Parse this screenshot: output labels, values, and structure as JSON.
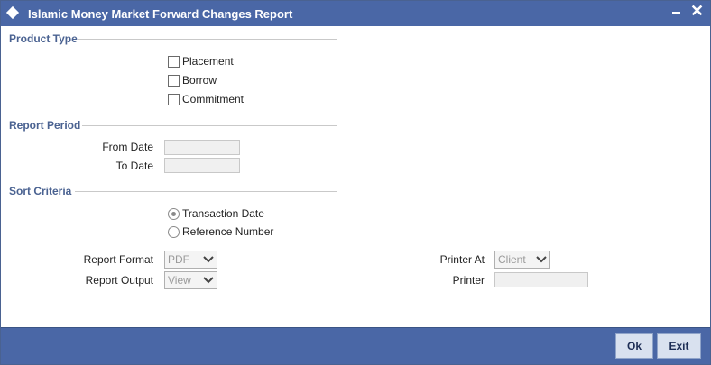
{
  "window": {
    "title": "Islamic Money Market Forward Changes Report"
  },
  "product_type": {
    "heading": "Product Type",
    "options": [
      {
        "label": "Placement",
        "checked": false
      },
      {
        "label": "Borrow",
        "checked": false
      },
      {
        "label": "Commitment",
        "checked": false
      }
    ]
  },
  "report_period": {
    "heading": "Report Period",
    "from_date_label": "From Date",
    "from_date_value": "",
    "to_date_label": "To Date",
    "to_date_value": ""
  },
  "sort_criteria": {
    "heading": "Sort Criteria",
    "options": [
      {
        "label": "Transaction Date",
        "selected": true
      },
      {
        "label": "Reference Number",
        "selected": false
      }
    ]
  },
  "report_format": {
    "label": "Report Format",
    "value": "PDF"
  },
  "report_output": {
    "label": "Report Output",
    "value": "View"
  },
  "printer_at": {
    "label": "Printer At",
    "value": "Client"
  },
  "printer": {
    "label": "Printer",
    "value": ""
  },
  "buttons": {
    "ok": "Ok",
    "exit": "Exit"
  },
  "colors": {
    "titlebar": "#4a67a6",
    "section_heading": "#4a6291",
    "button_bg": "#d9e1ef"
  },
  "icons": {
    "title": "diamond-icon",
    "minimize": "minimize-icon",
    "close": "close-icon",
    "dropdown": "chevron-down-icon"
  }
}
